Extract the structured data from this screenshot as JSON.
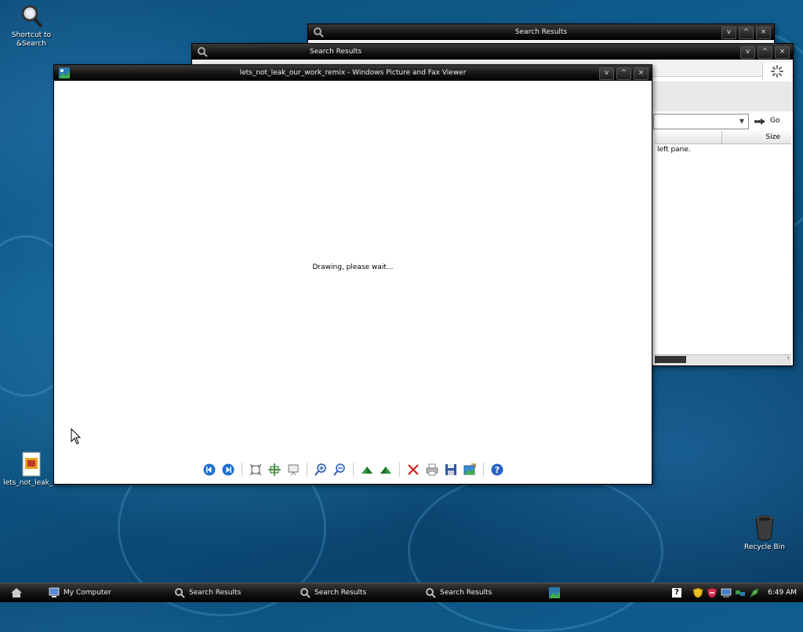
{
  "desktop": {
    "icons": [
      {
        "label": "Shortcut to &Search"
      },
      {
        "label": "lets_not_leak_..."
      },
      {
        "label": "Recycle Bin"
      }
    ]
  },
  "windows": {
    "search_back": {
      "title": "Search Results"
    },
    "search_front": {
      "title": "Search Results",
      "go_label": "Go",
      "col_size": "Size",
      "body_text": "left pane."
    },
    "viewer": {
      "title": "lets_not_leak_our_work_remix - Windows Picture and Fax Viewer",
      "status": "Drawing, please wait..."
    }
  },
  "window_controls": {
    "minimize": "v",
    "maximize": "^",
    "close": "×"
  },
  "taskbar": {
    "items": [
      {
        "label": "My Computer"
      },
      {
        "label": "Search Results"
      },
      {
        "label": "Search Results"
      },
      {
        "label": "Search Results"
      }
    ],
    "clock": "6:49 AM"
  },
  "colors": {
    "accent": "#0f5e8f",
    "titlebar": "#111111"
  }
}
